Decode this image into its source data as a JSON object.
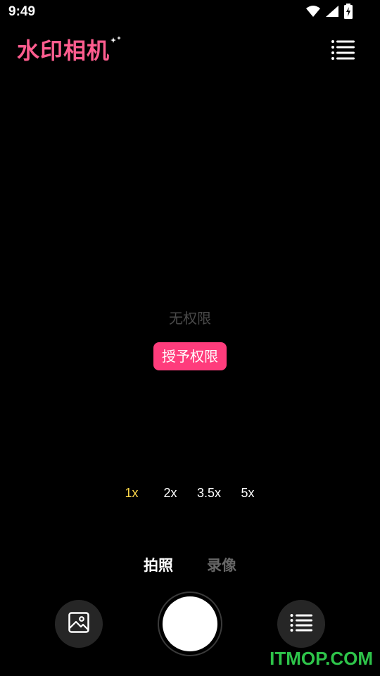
{
  "status_bar": {
    "time": "9:49",
    "icons": [
      "wifi-icon",
      "cellular-signal-icon",
      "battery-charging-icon"
    ]
  },
  "header": {
    "logo_text": "水印相机",
    "logo_color": "#ff5d8f",
    "menu_icon": "list-menu-icon"
  },
  "preview": {
    "no_permission_text": "无权限",
    "grant_button_label": "授予权限",
    "accent_color": "#ff3c7c"
  },
  "zoom": {
    "options": [
      "1x",
      "2x",
      "3.5x",
      "5x"
    ],
    "selected": "1x",
    "selected_color": "#ffd84a"
  },
  "modes": {
    "tabs": [
      "拍照",
      "录像"
    ],
    "active": "拍照"
  },
  "controls": {
    "gallery_icon": "image-gallery-icon",
    "shutter": "shutter-button",
    "list_icon": "list-menu-icon"
  },
  "watermark": {
    "text": "ITMOP.COM",
    "color": "#2ec44a"
  }
}
